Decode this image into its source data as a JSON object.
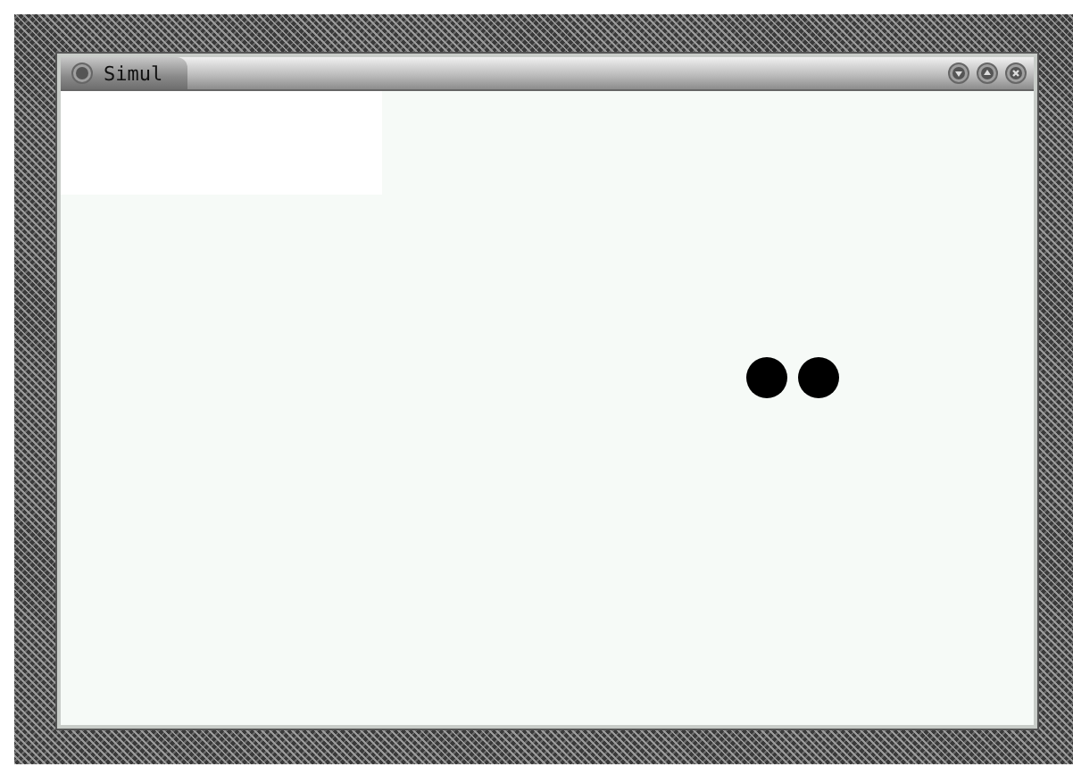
{
  "window": {
    "title": "Simul"
  }
}
